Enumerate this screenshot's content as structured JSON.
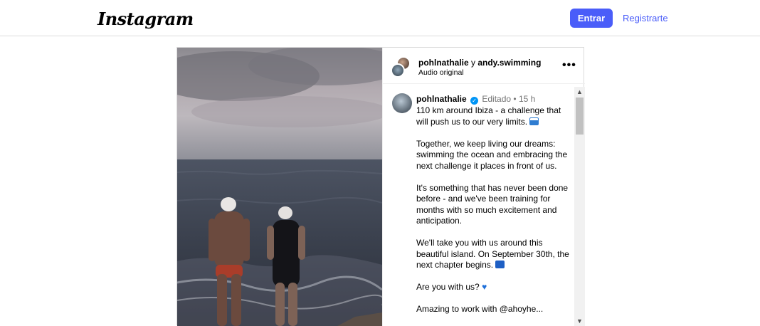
{
  "header": {
    "logo": "Instagram",
    "login_label": "Entrar",
    "register_label": "Registrarte"
  },
  "post": {
    "authors": {
      "first": "pohlnathalie",
      "joiner": " y ",
      "second": "andy.swimming"
    },
    "audio": "Audio original",
    "more_label": "•••",
    "caption": {
      "user": "pohlnathalie",
      "edited": "Editado",
      "separator": " • ",
      "time": "15 h",
      "paragraphs": [
        "110 km around Ibiza - a challenge that will push us to our very limits.",
        "Together, we keep living our dreams: swimming the ocean and embracing the next challenge it places in front of us.",
        "It's something that has never been done before - and we've been training for months with so much excitement and anticipation.",
        "We'll take you with us around this beautiful island. On September 30th, the next chapter begins.",
        "Are you with us?",
        "Amazing to work with @ahoyhe..."
      ]
    }
  },
  "colors": {
    "accent": "#4a5df9",
    "verified": "#0095f6",
    "border": "#dbdbdb"
  },
  "icons": [
    "wave-emoji-icon",
    "flag-emoji-icon",
    "blue-heart-icon",
    "verified-badge-icon",
    "more-options-icon"
  ]
}
